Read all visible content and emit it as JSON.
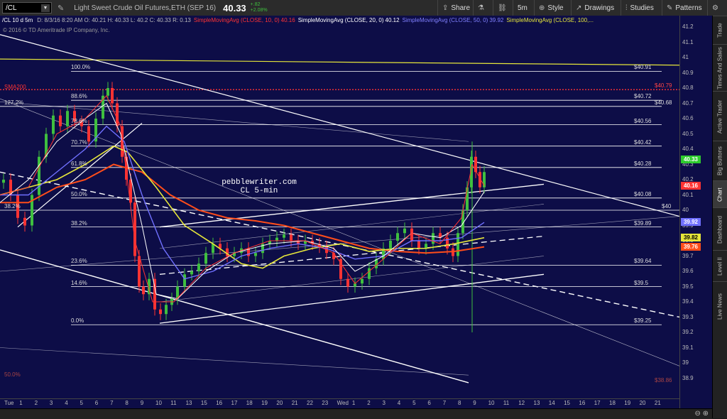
{
  "toolbar": {
    "symbol": "/CL",
    "instrument": "Light Sweet Crude Oil Futures,ETH (SEP 16)",
    "last_price": "40.33",
    "change": "+.82",
    "change_pct": "+2.08%",
    "share_label": "Share",
    "interval_label": "5m",
    "style_label": "Style",
    "drawings_label": "Drawings",
    "studies_label": "Studies",
    "patterns_label": "Patterns"
  },
  "studyline": {
    "bar_info": "/CL 10 d 5m",
    "ohlc": "D: 8/3/16 8:20 AM   O: 40.21   H: 40.33   L: 40.2   C: 40.33   R: 0.13",
    "sma10_label": "SimpleMovingAvg (CLOSE, 10, 0)",
    "sma10_val": "40.16",
    "sma20_label": "SimpleMovingAvg (CLOSE, 20, 0)",
    "sma20_val": "40.12",
    "sma50_label": "SimpleMovingAvg (CLOSE, 50, 0)",
    "sma50_val": "39.92",
    "sma100_label": "SimpleMovingAvg (CLOSE, 100,..."
  },
  "copyright": "© 2016 © TD Ameritrade IP Company, Inc.",
  "annotation": {
    "line1": "pebblewriter.com",
    "line2": "CL 5-min"
  },
  "colors": {
    "background": "#0d0d47",
    "sma10": "#ff3333",
    "sma20": "#ffffff",
    "sma50": "#7070ff",
    "sma100": "#e6e63a",
    "sma200": "#ff4d1a",
    "up_candle": "#3fbf3f",
    "down_candle": "#ff3333"
  },
  "fib_labels": [
    {
      "text": "100.0%",
      "price": 40.91
    },
    {
      "text": "88.6%",
      "price": 40.72
    },
    {
      "text": "78.6%",
      "price": 40.56
    },
    {
      "text": "70.7%",
      "price": 40.42
    },
    {
      "text": "61.8%",
      "price": 40.28
    },
    {
      "text": "50.0%",
      "price": 40.08
    },
    {
      "text": "38.2%",
      "price": 39.89
    },
    {
      "text": "23.6%",
      "price": 39.64
    },
    {
      "text": "14.6%",
      "price": 39.5
    },
    {
      "text": "0.0%",
      "price": 39.25
    },
    {
      "text": "127.2%",
      "price": 40.68
    },
    {
      "text": "38.2%",
      "price": 40.0
    },
    {
      "text": "50.0%",
      "price": 38.9
    }
  ],
  "level_values": [
    {
      "text": "$40.91",
      "price": 40.91
    },
    {
      "text": "$40.72",
      "price": 40.72
    },
    {
      "text": "$40.68",
      "price": 40.68
    },
    {
      "text": "$40.56",
      "price": 40.56
    },
    {
      "text": "$40.42",
      "price": 40.42
    },
    {
      "text": "$40.28",
      "price": 40.28
    },
    {
      "text": "$40.08",
      "price": 40.08
    },
    {
      "text": "$40",
      "price": 40.0
    },
    {
      "text": "$39.89",
      "price": 39.89
    },
    {
      "text": "$39.64",
      "price": 39.64
    },
    {
      "text": "$39.5",
      "price": 39.5
    },
    {
      "text": "$39.25",
      "price": 39.25
    },
    {
      "text": "$40.79",
      "price": 40.79
    },
    {
      "text": "$38.86",
      "price": 38.86
    }
  ],
  "sma200_label": "SMA200",
  "y_ticks": [
    "41.2",
    "41.1",
    "41",
    "40.9",
    "40.8",
    "40.7",
    "40.6",
    "40.5",
    "40.4",
    "40.3",
    "40.2",
    "40.1",
    "40",
    "39.9",
    "39.8",
    "39.7",
    "39.6",
    "39.5",
    "39.4",
    "39.3",
    "39.2",
    "39.1",
    "39",
    "38.9"
  ],
  "price_boxes": [
    {
      "text": "40.33",
      "price": 40.33,
      "bg": "#2ecc2e",
      "fg": "#ffffff"
    },
    {
      "text": "40.16",
      "price": 40.16,
      "bg": "#ff3333",
      "fg": "#ffffff"
    },
    {
      "text": "39.92",
      "price": 39.92,
      "bg": "#7070ff",
      "fg": "#ffffff"
    },
    {
      "text": "39.82",
      "price": 39.82,
      "bg": "#e6e63a",
      "fg": "#000000"
    },
    {
      "text": "39.76",
      "price": 39.76,
      "bg": "#ff4d1a",
      "fg": "#ffffff"
    }
  ],
  "x_ticks": [
    "Tue",
    "1",
    "2",
    "3",
    "4",
    "5",
    "6",
    "7",
    "8",
    "9",
    "10",
    "11",
    "13",
    "15",
    "16",
    "17",
    "18",
    "19",
    "20",
    "21",
    "22",
    "23",
    "Wed",
    "1",
    "2",
    "3",
    "4",
    "5",
    "6",
    "7",
    "8",
    "9",
    "10",
    "11",
    "12",
    "13",
    "14",
    "15",
    "16",
    "17",
    "18",
    "19",
    "20",
    "21"
  ],
  "sidebar": [
    "Trade",
    "Times And Sales",
    "Active Trader",
    "Big Buttons",
    "Chart",
    "Dashboard",
    "Level II",
    "Live News"
  ],
  "sidebar_active": "Chart"
}
